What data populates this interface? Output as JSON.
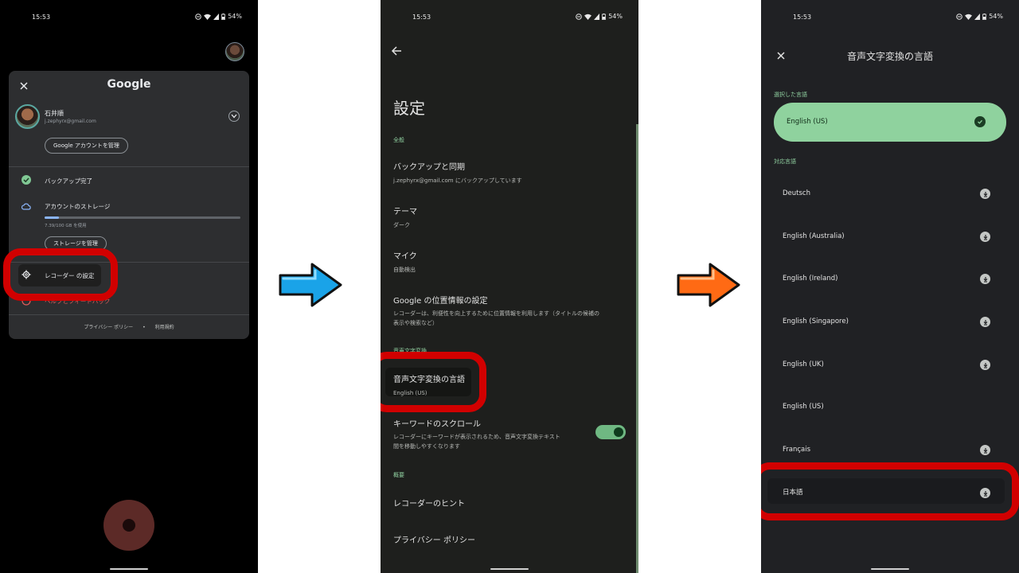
{
  "status": {
    "time": "15:53",
    "battery": "54%"
  },
  "screen1": {
    "panel_title": "Google",
    "account_name": "石井順",
    "account_email": "j.zephyrx@gmail.com",
    "manage_account": "Google アカウントを管理",
    "backup_done": "バックアップ完了",
    "storage_label": "アカウントのストレージ",
    "storage_usage": "7.39/100 GB を使用",
    "storage_used_fraction": 0.074,
    "manage_storage": "ストレージを管理",
    "recorder_settings": "レコーダー の設定",
    "help_feedback": "ヘルプとフィードバック",
    "privacy_policy": "プライバシー ポリシー",
    "terms": "利用規約"
  },
  "screen2": {
    "title": "設定",
    "section_general": "全般",
    "backup_title": "バックアップと同期",
    "backup_sub": "j.zephyrx@gmail.com にバックアップしています",
    "theme_title": "テーマ",
    "theme_sub": "ダーク",
    "mic_title": "マイク",
    "mic_sub": "自動検出",
    "location_title": "Google の位置情報の設定",
    "location_sub1": "レコーダーは、利便性を向上するために位置情報を利用します（タイトルの候補の",
    "location_sub2": "表示や検索など）",
    "section_speech": "音声文字変換",
    "lang_title": "音声文字変換の言語",
    "lang_sub": "English (US)",
    "keyword_title": "キーワードのスクロール",
    "keyword_sub1": "レコーダーにキーワードが表示されるため、音声文字変換テキスト",
    "keyword_sub2": "間を移動しやすくなります",
    "section_about": "概要",
    "hints": "レコーダーのヒント",
    "privacy": "プライバシー ポリシー"
  },
  "screen3": {
    "header": "音声文字変換の言語",
    "section_selected": "選択した言語",
    "selected_language": "English (US)",
    "section_supported": "対応言語",
    "languages": [
      "Deutsch",
      "English (Australia)",
      "English (Ireland)",
      "English (Singapore)",
      "English (UK)",
      "English (US)",
      "Français",
      "日本語"
    ]
  },
  "colors": {
    "highlight_red": "#d10000",
    "arrow_blue": "#1aa3e8",
    "arrow_orange": "#ff6a14",
    "accent_green": "#8fd29e"
  }
}
